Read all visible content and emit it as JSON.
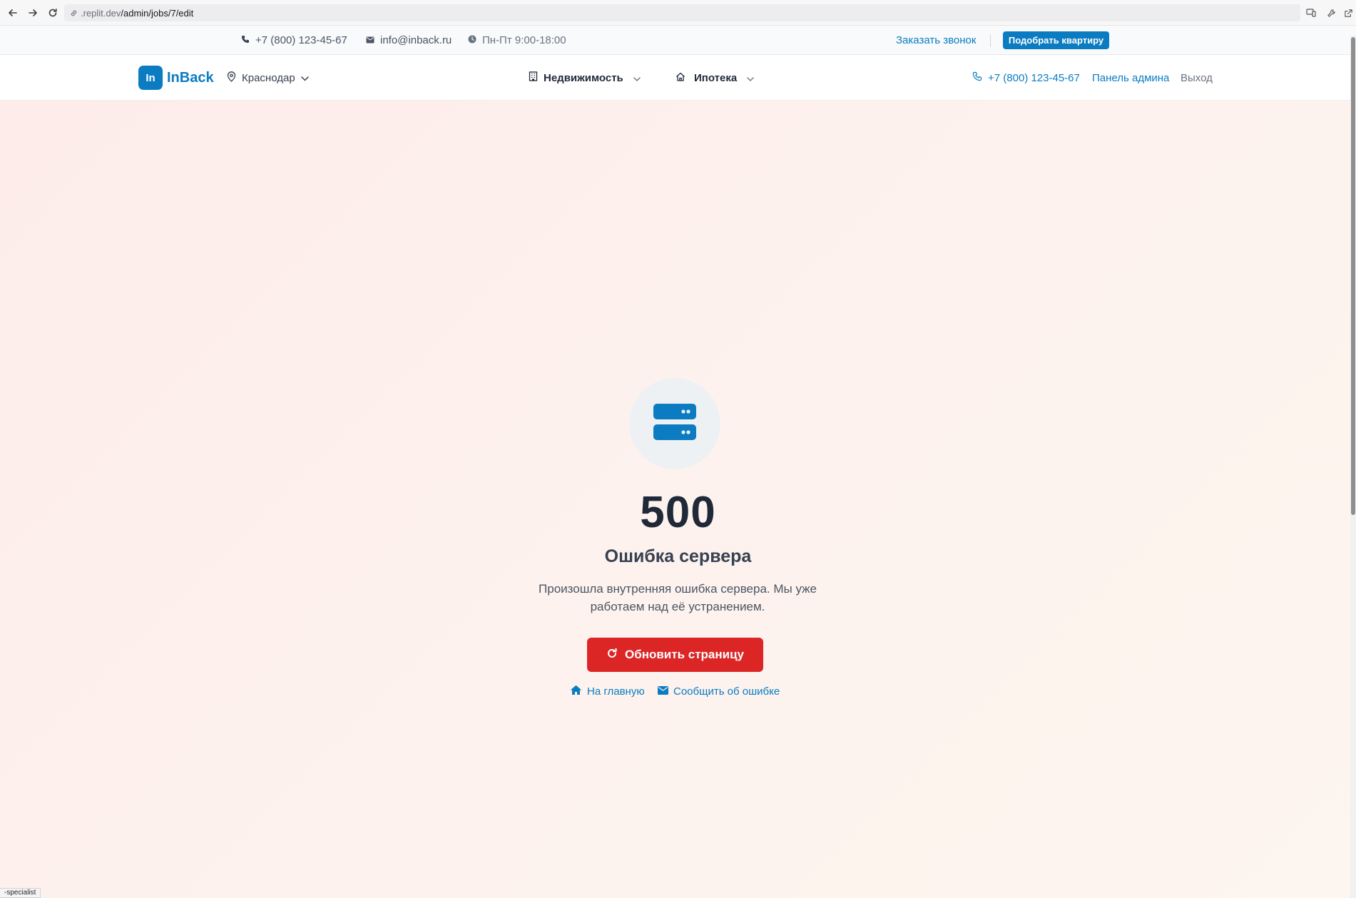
{
  "browser": {
    "url_host": ".replit.dev",
    "url_path": "/admin/jobs/7/edit"
  },
  "topbar": {
    "phone": "+7 (800) 123-45-67",
    "email": "info@inback.ru",
    "hours": "Пн-Пт 9:00-18:00",
    "callback_label": "Заказать звонок",
    "cta_label": "Подобрать квартиру"
  },
  "header": {
    "logo_badge": "In",
    "logo_text": "InBack",
    "city": "Краснодар",
    "nav": [
      {
        "label": "Недвижимость",
        "icon": "building-icon"
      },
      {
        "label": "Ипотека",
        "icon": "home-icon"
      }
    ],
    "phone": "+7 (800) 123-45-67",
    "admin_label": "Панель админа",
    "logout_label": "Выход"
  },
  "error": {
    "icon": "server-icon",
    "code": "500",
    "title": "Ошибка сервера",
    "description": "Произошла внутренняя ошибка сервера. Мы уже работаем над её устранением.",
    "refresh_label": "Обновить страницу",
    "home_label": "На главную",
    "report_label": "Сообщить об ошибке"
  },
  "status_tip": "-specialist",
  "colors": {
    "brand": "#0b7cc1",
    "danger": "#dc2626",
    "text_dark": "#1f2937"
  }
}
